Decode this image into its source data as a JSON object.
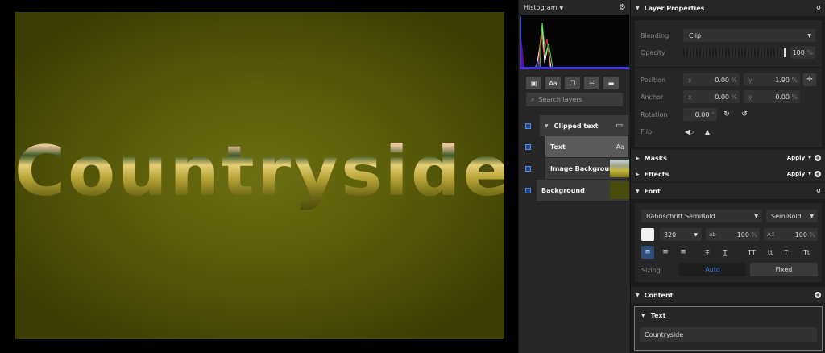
{
  "canvas": {
    "text": "Countryside"
  },
  "histogram": {
    "title": "Histogram"
  },
  "layers": {
    "search_placeholder": "Search layers",
    "toolbar": [
      "image-icon",
      "Aa",
      "duplicate-icon",
      "sliders-icon",
      "folder-icon"
    ],
    "items": [
      {
        "name": "Clipped text"
      },
      {
        "name": "Text",
        "badge": "Aa"
      },
      {
        "name": "Image Background"
      },
      {
        "name": "Background"
      }
    ]
  },
  "props": {
    "layer_title": "Layer Properties",
    "blending_label": "Blending",
    "blending_value": "Clip",
    "opacity_label": "Opacity",
    "opacity_value": "100",
    "opacity_unit": "%",
    "position_label": "Position",
    "pos_x_label": "x",
    "pos_x": "0.00",
    "pos_y_label": "y",
    "pos_y": "1.90",
    "pct": "%",
    "anchor_label": "Anchor",
    "anc_x_label": "x",
    "anc_x": "0.00",
    "anc_y_label": "y",
    "anc_y": "0.00",
    "rotation_label": "Rotation",
    "rotation_value": "0.00",
    "rotation_unit": "°",
    "flip_label": "Flip",
    "masks_title": "Masks",
    "effects_title": "Effects",
    "apply": "Apply",
    "font_title": "Font",
    "font_family": "Bahnschrift SemiBold",
    "font_weight": "SemiBold",
    "font_size": "320",
    "tracking": "100",
    "line_height": "100",
    "align_labels": [
      "TT",
      "tt",
      "Tт",
      "Tt"
    ],
    "sizing_label": "Sizing",
    "sizing_auto": "Auto",
    "sizing_fixed": "Fixed",
    "content_title": "Content",
    "text_sub": "Text",
    "text_value": "Countryside"
  },
  "colors": {
    "accent": "#2f7de1",
    "panel": "#262626"
  }
}
